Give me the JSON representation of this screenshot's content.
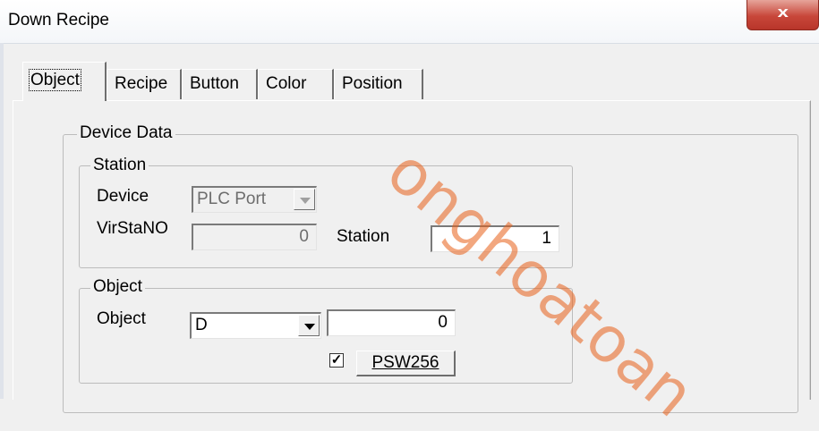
{
  "window": {
    "title": "Down Recipe",
    "close_glyph": "x"
  },
  "tabs": [
    {
      "label": "Object",
      "active": true
    },
    {
      "label": "Recipe"
    },
    {
      "label": "Button"
    },
    {
      "label": "Color"
    },
    {
      "label": "Position"
    }
  ],
  "device_data": {
    "label": "Device Data",
    "station_group": {
      "label": "Station",
      "device_label": "Device",
      "device_value": "PLC Port",
      "virstano_label": "VirStaNO",
      "virstano_value": "0",
      "station_label": "Station",
      "station_value": "1"
    },
    "object_group": {
      "label": "Object",
      "object_label": "Object",
      "object_type_value": "D",
      "address_value": "0",
      "checkbox_checked": true,
      "check_glyph": "✓",
      "psw_button_label": "PSW256"
    }
  },
  "watermark": "onghoatoan"
}
